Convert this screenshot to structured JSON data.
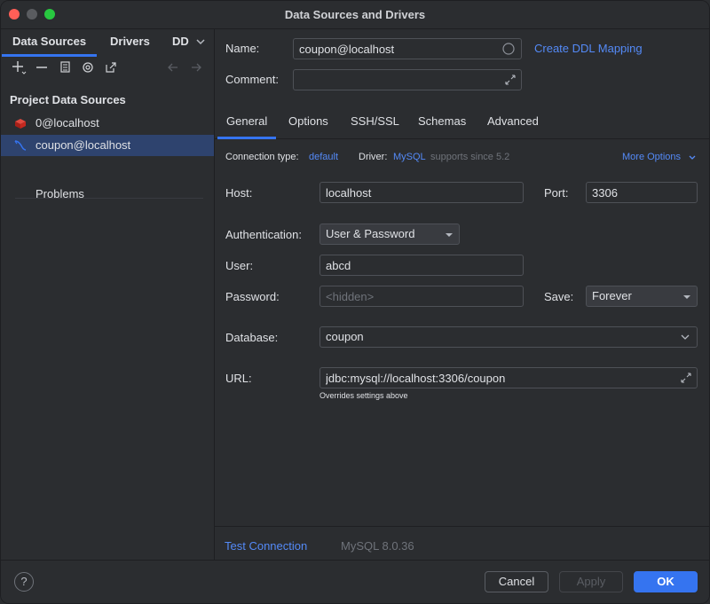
{
  "window": {
    "title": "Data Sources and Drivers"
  },
  "left": {
    "tabs": [
      "Data Sources",
      "Drivers",
      "DD"
    ],
    "section_title": "Project Data Sources",
    "items": [
      {
        "label": "0@localhost",
        "icon": "redis-icon"
      },
      {
        "label": "coupon@localhost",
        "icon": "mysql-dolphin-icon"
      }
    ],
    "problems": "Problems"
  },
  "form": {
    "name_label": "Name:",
    "name_value": "coupon@localhost",
    "ddl_link": "Create DDL Mapping",
    "comment_label": "Comment:",
    "comment_value": ""
  },
  "tabs": [
    "General",
    "Options",
    "SSH/SSL",
    "Schemas",
    "Advanced"
  ],
  "general": {
    "conn_type_label": "Connection type:",
    "conn_type_value": "default",
    "driver_label": "Driver:",
    "driver_value": "MySQL",
    "driver_note": "supports since 5.2",
    "more_options": "More Options",
    "host_label": "Host:",
    "host_value": "localhost",
    "port_label": "Port:",
    "port_value": "3306",
    "auth_label": "Authentication:",
    "auth_value": "User & Password",
    "user_label": "User:",
    "user_value": "abcd",
    "password_label": "Password:",
    "password_placeholder": "<hidden>",
    "save_label": "Save:",
    "save_value": "Forever",
    "database_label": "Database:",
    "database_value": "coupon",
    "url_label": "URL:",
    "url_value": "jdbc:mysql://localhost:3306/coupon",
    "url_note": "Overrides settings above"
  },
  "footer_panel": {
    "test_connection": "Test Connection",
    "version": "MySQL 8.0.36"
  },
  "buttons": {
    "help": "?",
    "cancel": "Cancel",
    "apply": "Apply",
    "ok": "OK"
  },
  "colors": {
    "accent": "#3574f0",
    "link": "#548af7",
    "selection": "#2e436e",
    "redis": "#d82c20"
  }
}
